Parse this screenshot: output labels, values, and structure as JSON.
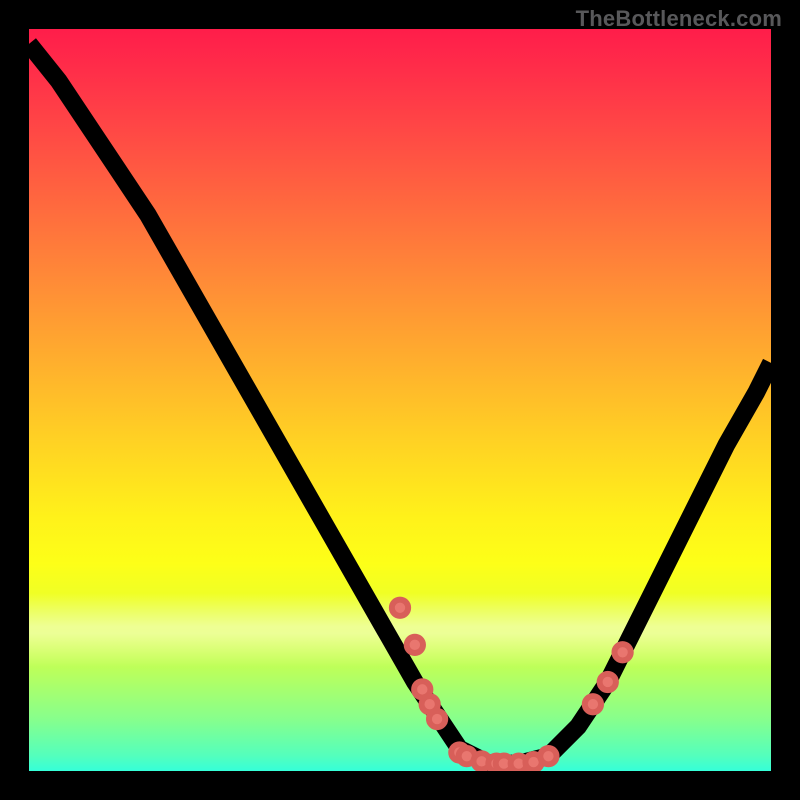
{
  "watermark": "TheBottleneck.com",
  "chart_data": {
    "type": "line",
    "title": "",
    "xlabel": "",
    "ylabel": "",
    "xlim": [
      0,
      100
    ],
    "ylim": [
      0,
      100
    ],
    "legend": false,
    "grid": false,
    "background": "rainbow-gradient-vertical",
    "series": [
      {
        "name": "bottleneck-curve",
        "x": [
          0,
          4,
          8,
          12,
          16,
          20,
          24,
          28,
          32,
          36,
          40,
          44,
          48,
          52,
          56,
          58,
          62,
          66,
          70,
          74,
          78,
          82,
          86,
          90,
          94,
          98,
          100
        ],
        "y": [
          98,
          93,
          87,
          81,
          75,
          68,
          61,
          54,
          47,
          40,
          33,
          26,
          19,
          12,
          6,
          3,
          1,
          1,
          2,
          6,
          12,
          20,
          28,
          36,
          44,
          51,
          55
        ],
        "stroke": "#000000"
      }
    ],
    "points": [
      {
        "name": "marker",
        "x": 50,
        "y": 22,
        "r": 1.1
      },
      {
        "name": "marker",
        "x": 52,
        "y": 17,
        "r": 1.1
      },
      {
        "name": "marker",
        "x": 53,
        "y": 11,
        "r": 1.1
      },
      {
        "name": "marker",
        "x": 54,
        "y": 9,
        "r": 1.1
      },
      {
        "name": "marker",
        "x": 55,
        "y": 7,
        "r": 1.1
      },
      {
        "name": "marker",
        "x": 58,
        "y": 2.5,
        "r": 1.1
      },
      {
        "name": "marker",
        "x": 59,
        "y": 2,
        "r": 1.1
      },
      {
        "name": "marker",
        "x": 61,
        "y": 1.3,
        "r": 1.1
      },
      {
        "name": "marker",
        "x": 63,
        "y": 1,
        "r": 1.1
      },
      {
        "name": "marker",
        "x": 64,
        "y": 1,
        "r": 1.1
      },
      {
        "name": "marker",
        "x": 66,
        "y": 1,
        "r": 1.1
      },
      {
        "name": "marker",
        "x": 68,
        "y": 1.2,
        "r": 1.1
      },
      {
        "name": "marker",
        "x": 70,
        "y": 2,
        "r": 1.1
      },
      {
        "name": "marker",
        "x": 76,
        "y": 9,
        "r": 1.1
      },
      {
        "name": "marker",
        "x": 78,
        "y": 12,
        "r": 1.1
      },
      {
        "name": "marker",
        "x": 80,
        "y": 16,
        "r": 1.1
      }
    ],
    "colors": {
      "gradient_top": "#ff1d4a",
      "gradient_mid": "#ffe81d",
      "gradient_bottom": "#35ffd9",
      "curve": "#000000",
      "markers": "#e9766f",
      "frame": "#000000"
    }
  }
}
